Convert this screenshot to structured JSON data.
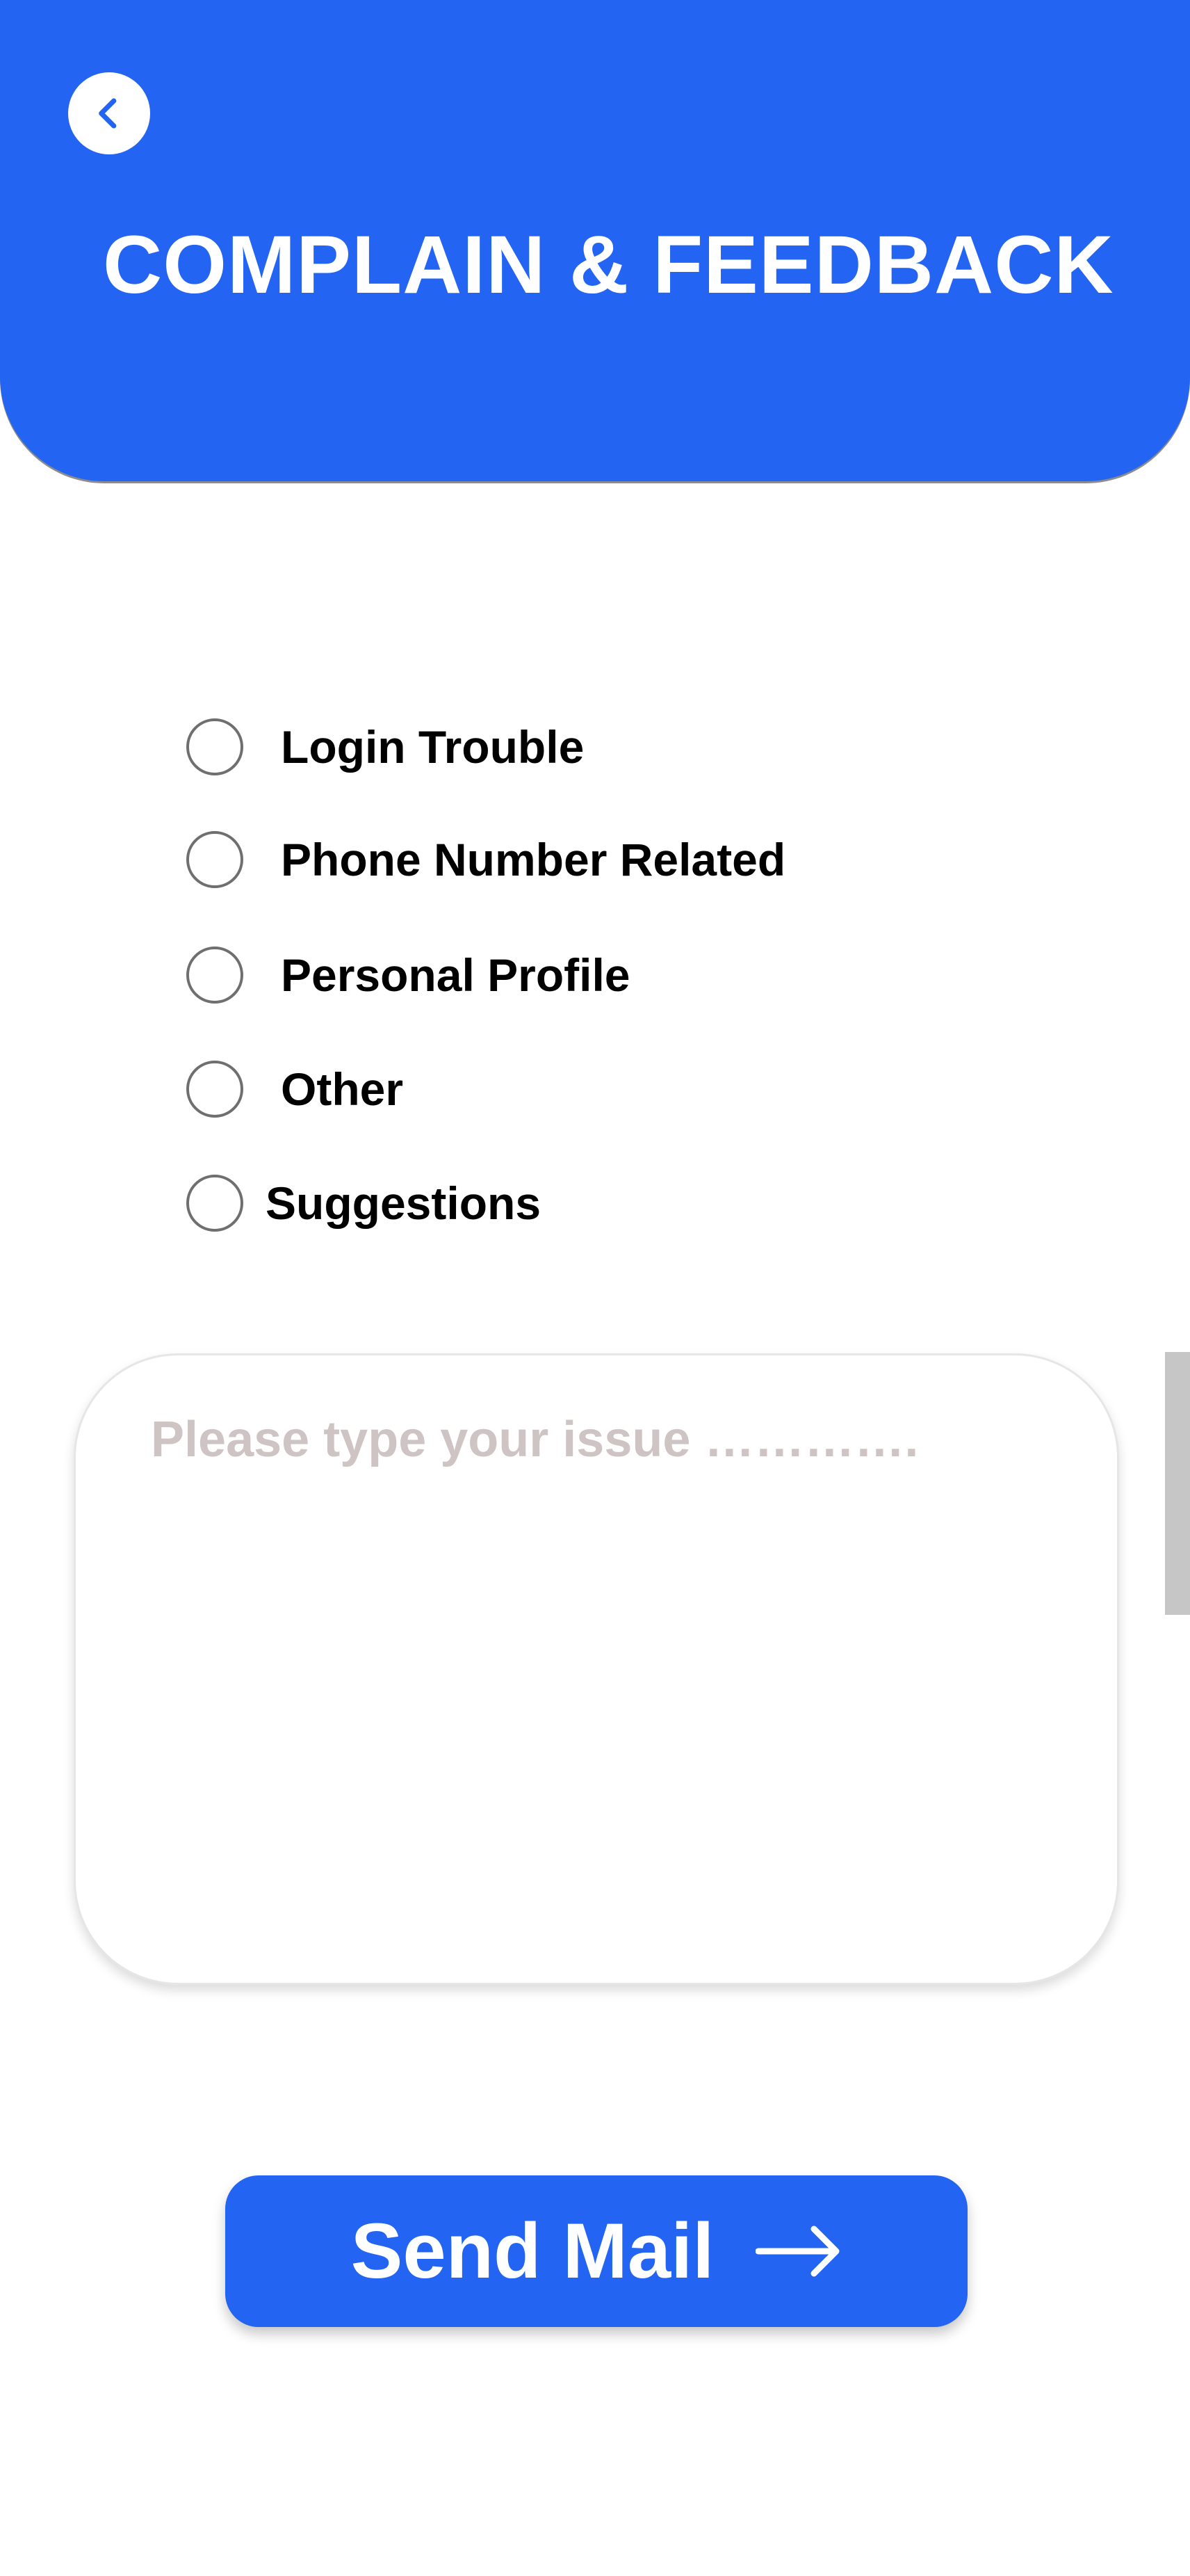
{
  "colors": {
    "primary": "#2364f2",
    "text": "#000000",
    "placeholder": "#cfc4c4",
    "radio_border": "#6f6f6f",
    "scrollbar": "#c6c6c6"
  },
  "header": {
    "back_icon": "chevron-left-icon",
    "title": "COMPLAIN & FEEDBACK"
  },
  "options": [
    {
      "label": "Login Trouble",
      "selected": false
    },
    {
      "label": "Phone Number Related",
      "selected": false
    },
    {
      "label": "Personal Profile",
      "selected": false
    },
    {
      "label": "Other",
      "selected": false
    },
    {
      "label": "Suggestions",
      "selected": false
    }
  ],
  "issue": {
    "placeholder": "Please type your issue ………….",
    "value": ""
  },
  "send": {
    "label": "Send Mail",
    "icon": "arrow-right-icon"
  }
}
